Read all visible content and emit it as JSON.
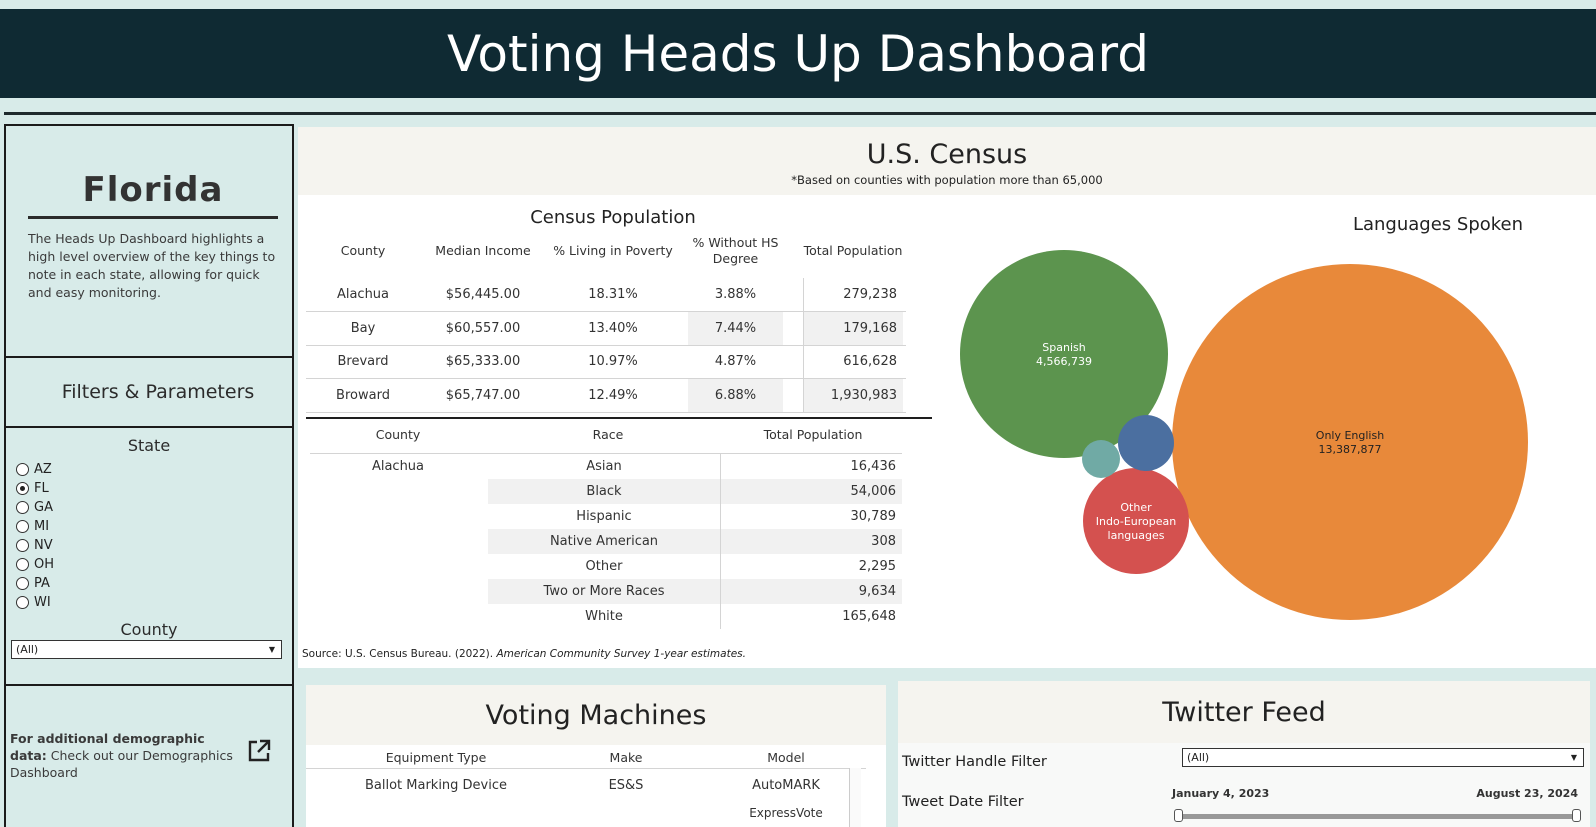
{
  "header": {
    "title": "Voting Heads Up Dashboard"
  },
  "sidebar": {
    "state_name": "Florida",
    "description": "The Heads Up Dashboard highlights a high level overview of the key things to note in each state, allowing for quick and easy monitoring.",
    "filters_title": "Filters & Parameters",
    "state_label": "State",
    "states": [
      "AZ",
      "FL",
      "GA",
      "MI",
      "NV",
      "OH",
      "PA",
      "WI"
    ],
    "selected_state": "FL",
    "county_label": "County",
    "county_value": "(All)",
    "link_bold": "For additional demographic data:",
    "link_text": " Check out our Demographics Dashboard"
  },
  "census": {
    "title": "U.S. Census",
    "note": "*Based on counties with population more than 65,000",
    "population_title": "Census Population",
    "population_headers": [
      "County",
      "Median Income",
      "% Living in Poverty",
      "% Without HS Degree",
      "Total Population"
    ],
    "population_rows": [
      [
        "Alachua",
        "$56,445.00",
        "18.31%",
        "3.88%",
        "279,238"
      ],
      [
        "Bay",
        "$60,557.00",
        "13.40%",
        "7.44%",
        "179,168"
      ],
      [
        "Brevard",
        "$65,333.00",
        "10.97%",
        "4.87%",
        "616,628"
      ],
      [
        "Broward",
        "$65,747.00",
        "12.49%",
        "6.88%",
        "1,930,983"
      ]
    ],
    "race_headers": [
      "County",
      "Race",
      "Total Population"
    ],
    "race_county": "Alachua",
    "race_rows": [
      [
        "Asian",
        "16,436"
      ],
      [
        "Black",
        "54,006"
      ],
      [
        "Hispanic",
        "30,789"
      ],
      [
        "Native American",
        "308"
      ],
      [
        "Other",
        "2,295"
      ],
      [
        "Two or More Races",
        "9,634"
      ],
      [
        "White",
        "165,648"
      ]
    ],
    "source_prefix": "Source: U.S. Census Bureau. (2022). ",
    "source_italic": "American Community Survey 1-year estimates."
  },
  "languages": {
    "title": "Languages Spoken",
    "bubbles": [
      {
        "label": "Spanish",
        "value": "4,566,739",
        "color": "#5c944e"
      },
      {
        "label": "Only English",
        "value": "13,387,877",
        "color": "#e8893a"
      },
      {
        "label": "Other Indo-European languages",
        "value": "",
        "color": "#d4514f"
      },
      {
        "label": "",
        "value": "",
        "color": "#4b6fa0"
      },
      {
        "label": "",
        "value": "",
        "color": "#70aaa5"
      }
    ]
  },
  "voting_machines": {
    "title": "Voting Machines",
    "headers": [
      "Equipment Type",
      "Make",
      "Model"
    ],
    "rows": [
      [
        "Ballot Marking Device",
        "ES&S",
        "AutoMARK"
      ]
    ],
    "partial_text": "ExpressVote"
  },
  "twitter": {
    "title": "Twitter Feed",
    "handle_label": "Twitter Handle Filter",
    "handle_value": "(All)",
    "date_label": "Tweet Date Filter",
    "date_start": "January 4, 2023",
    "date_end": "August 23, 2024"
  }
}
